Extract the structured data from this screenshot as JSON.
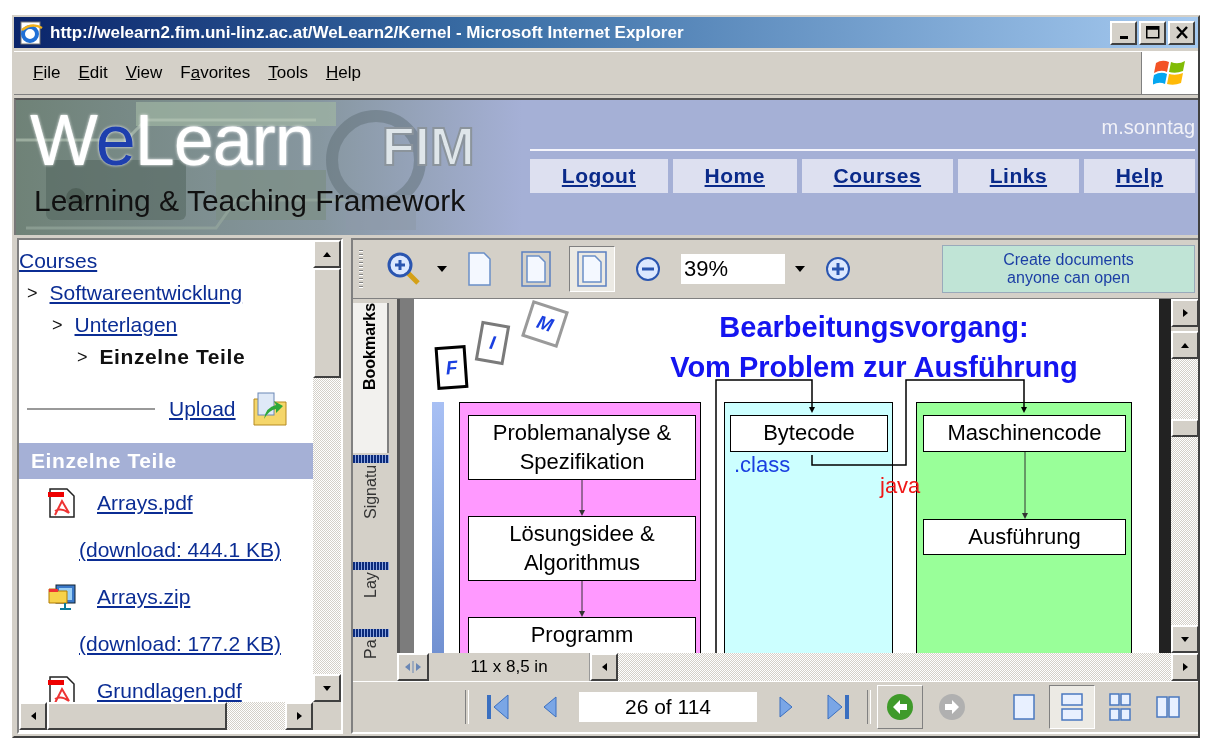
{
  "window": {
    "title": "http://welearn2.fim.uni-linz.ac.at/WeLearn2/Kernel - Microsoft Internet Explorer"
  },
  "menu": [
    {
      "key": "F",
      "rest": "ile"
    },
    {
      "key": "E",
      "rest": "dit"
    },
    {
      "key": "V",
      "rest": "iew"
    },
    {
      "lead": "F",
      "key": "a",
      "rest": "vorites"
    },
    {
      "key": "T",
      "rest": "ools"
    },
    {
      "key": "H",
      "rest": "elp"
    }
  ],
  "banner": {
    "logo": [
      {
        "text": "W",
        "color": "#ffffff"
      },
      {
        "text": "e",
        "color": "#1e3fae"
      },
      {
        "text": "Learn",
        "color": "#ffffff"
      }
    ],
    "logo_badge": "FIM",
    "tagline": "Learning & Teaching Framework",
    "user": "m.sonntag",
    "nav": [
      "Logout",
      "Home",
      "Courses",
      "Links",
      "Help"
    ]
  },
  "sidebar": {
    "breadcrumb": {
      "label": "Courses",
      "link": true,
      "children": [
        {
          "marker": ">",
          "label": "Softwareentwicklung",
          "link": true,
          "children": [
            {
              "marker": ">",
              "label": "Unterlagen",
              "link": true,
              "children": [
                {
                  "marker": ">",
                  "label": "Einzelne Teile",
                  "link": false
                }
              ]
            }
          ]
        }
      ]
    },
    "upload": "Upload",
    "section_title": "Einzelne Teile",
    "files": [
      {
        "kind": "pdf",
        "name": "Arrays.pdf",
        "size": "(download: 444.1 KB)"
      },
      {
        "kind": "zip",
        "name": "Arrays.zip",
        "size": "(download: 177.2 KB)"
      },
      {
        "kind": "pdf",
        "name": "Grundlagen.pdf"
      }
    ]
  },
  "pdf_viewer": {
    "toolbar": {
      "page_views": [
        {
          "kind": "page",
          "selected": false
        },
        {
          "kind": "framed",
          "selected": false
        },
        {
          "kind": "framed",
          "selected": true
        }
      ],
      "zoom": "39%",
      "promo": "Create documents anyone can open"
    },
    "side_tabs": [
      {
        "label": "Bookmarks",
        "selected": true
      },
      {
        "label": "Signatu",
        "selected": false
      },
      {
        "label": "Lay",
        "selected": false
      },
      {
        "label": "Pa",
        "selected": false
      }
    ],
    "slide": {
      "title_lines": [
        "Bearbeitungsvorgang:",
        "Vom Problem zur Ausführung"
      ],
      "logo_letters": [
        {
          "text": "F",
          "color": "#000000"
        },
        {
          "text": "I",
          "color": "#7a7a7a"
        },
        {
          "text": "M",
          "color": "#9a9a9a"
        }
      ],
      "columns": [
        {
          "color": "#ff99ff",
          "boxes": [
            "Problemanalyse & Spezifikation",
            "Lösungsidee & Algorithmus",
            "Programm"
          ]
        },
        {
          "color": "#ccffff",
          "boxes": [
            "Bytecode"
          ],
          "note": ".class"
        },
        {
          "color": "#99ff99",
          "boxes": [
            "Maschinencode",
            "Ausführung"
          ]
        }
      ],
      "connector_label": "java"
    },
    "page_size": "11 x 8,5 in",
    "navigation": {
      "page": "26 of 114",
      "back_enabled": true,
      "forward_enabled": false,
      "views": [
        {
          "kind": "single",
          "selected": false
        },
        {
          "kind": "continuous",
          "selected": true
        },
        {
          "kind": "grid",
          "selected": false
        },
        {
          "kind": "facing",
          "selected": false
        }
      ]
    }
  }
}
